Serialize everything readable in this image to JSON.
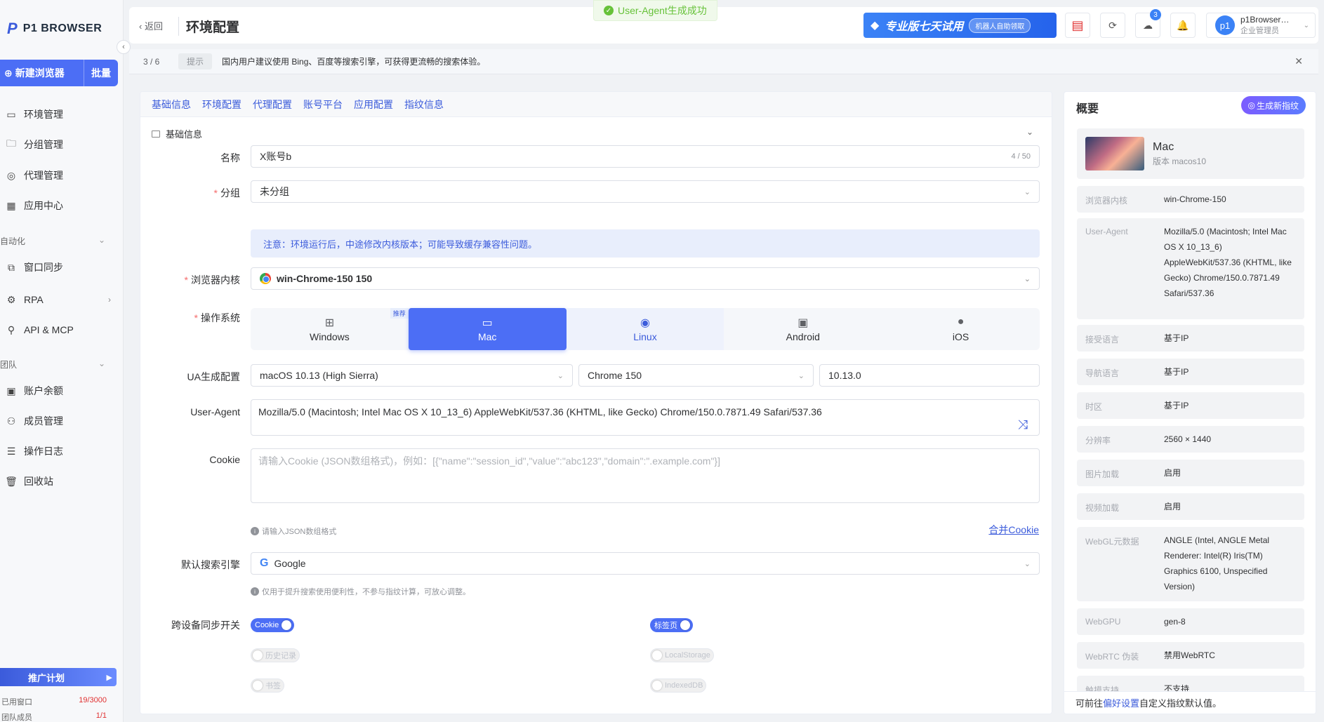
{
  "sidebar": {
    "logo_text": "P1 BROWSER",
    "new_browser": "新建浏览器",
    "batch": "批量",
    "items": [
      {
        "label": "环境管理"
      },
      {
        "label": "分组管理"
      },
      {
        "label": "代理管理"
      },
      {
        "label": "应用中心"
      },
      {
        "label": "窗口同步"
      },
      {
        "label": "RPA"
      },
      {
        "label": "API & MCP"
      },
      {
        "label": "账户余额"
      },
      {
        "label": "成员管理"
      },
      {
        "label": "操作日志"
      },
      {
        "label": "回收站"
      }
    ],
    "section_auto": "自动化",
    "section_team": "团队",
    "promo": "推广计划",
    "used_windows_label": "已用窗口",
    "used_windows_value": "19/3000",
    "team_members_label": "团队成员",
    "team_members_value": "1/1"
  },
  "topbar": {
    "back": "返回",
    "title": "环境配置",
    "toast": "User-Agent生成成功",
    "trial": "专业版七天试用",
    "trial_pill": "机器人自助领取",
    "download_badge": "3",
    "user_name": "p1Browser…",
    "user_role": "企业管理员",
    "avatar": "p1"
  },
  "tipbar": {
    "step": "3 / 6",
    "tag": "提示",
    "message": "国内用户建议使用 Bing、百度等搜索引擎，可获得更流畅的搜索体验。"
  },
  "form": {
    "tabs": [
      "基础信息",
      "环境配置",
      "代理配置",
      "账号平台",
      "应用配置",
      "指纹信息"
    ],
    "section_title": "基础信息",
    "name_label": "名称",
    "name_value": "X账号b",
    "name_count": "4 / 50",
    "group_label": "分组",
    "group_value": "未分组",
    "notice": "注意：环境运行后，中途修改内核版本；可能导致缓存兼容性问题。",
    "kernel_label": "浏览器内核",
    "kernel_value": "win-Chrome-150 150",
    "os_label": "操作系统",
    "os_options": [
      "Windows",
      "Mac",
      "Linux",
      "Android",
      "iOS"
    ],
    "os_recommend": "推荐",
    "ua_config_label": "UA生成配置",
    "ua_os": "macOS 10.13 (High Sierra)",
    "ua_browser": "Chrome 150",
    "ua_version": "10.13.0",
    "ua_label": "User-Agent",
    "ua_value": "Mozilla/5.0 (Macintosh; Intel Mac OS X 10_13_6) AppleWebKit/537.36 (KHTML, like Gecko) Chrome/150.0.7871.49 Safari/537.36",
    "cookie_label": "Cookie",
    "cookie_placeholder": "请输入Cookie (JSON数组格式)，例如：[{\"name\":\"session_id\",\"value\":\"abc123\",\"domain\":\".example.com\"}]",
    "cookie_hint": "请输入JSON数组格式",
    "merge_cookie": "合并Cookie",
    "search_label": "默认搜索引擎",
    "search_value": "Google",
    "search_hint": "仅用于提升搜索使用便利性，不参与指纹计算，可放心调整。",
    "sync_label": "跨设备同步开关",
    "sync_cookie": "Cookie",
    "sync_tabs": "标签页",
    "sync_history": "历史记录",
    "sync_localstorage": "LocalStorage",
    "sync_bookmarks": "书签",
    "sync_indexeddb": "IndexedDB"
  },
  "summary": {
    "title": "概要",
    "gen_button": "生成新指纹",
    "os_name": "Mac",
    "os_version": "版本 macos10",
    "rows": [
      {
        "k": "浏览器内核",
        "v": "win-Chrome-150"
      },
      {
        "k": "User-Agent",
        "v": "Mozilla/5.0 (Macintosh; Intel Mac OS X 10_13_6) AppleWebKit/537.36 (KHTML, like Gecko) Chrome/150.0.7871.49 Safari/537.36"
      },
      {
        "k": "接受语言",
        "v": "基于IP"
      },
      {
        "k": "导航语言",
        "v": "基于IP"
      },
      {
        "k": "时区",
        "v": "基于IP"
      },
      {
        "k": "分辨率",
        "v": "2560 × 1440"
      },
      {
        "k": "图片加载",
        "v": "启用"
      },
      {
        "k": "视频加载",
        "v": "启用"
      },
      {
        "k": "WebGL元数据",
        "v": "ANGLE (Intel, ANGLE Metal Renderer: Intel(R) Iris(TM) Graphics 6100, Unspecified Version)"
      },
      {
        "k": "WebGPU",
        "v": "gen-8"
      },
      {
        "k": "WebRTC 伪装",
        "v": "禁用WebRTC"
      },
      {
        "k": "触摸支持",
        "v": "不支持"
      }
    ],
    "footer_prefix": "可前往",
    "footer_link": "偏好设置",
    "footer_suffix": "自定义指纹默认值。"
  }
}
